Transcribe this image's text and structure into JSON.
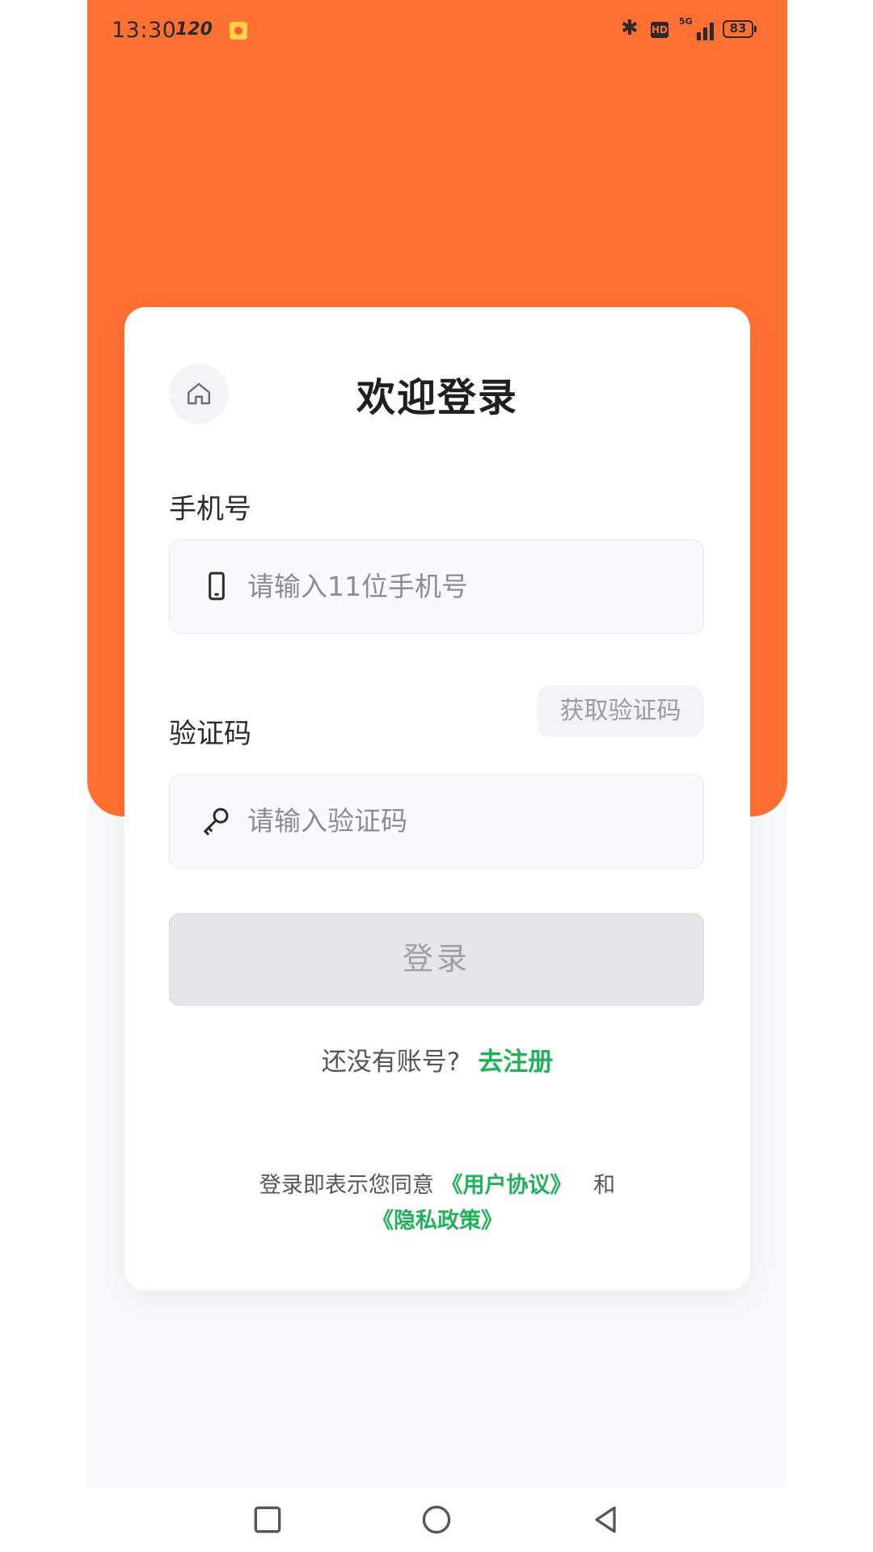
{
  "status_bar": {
    "time": "13:30",
    "refresh_rate": "120",
    "battery": "83",
    "network": "5G",
    "hd_label": "HD"
  },
  "login": {
    "title": "欢迎登录",
    "phone_label": "手机号",
    "phone_placeholder": "请输入11位手机号",
    "code_label": "验证码",
    "get_code_label": "获取验证码",
    "code_placeholder": "请输入验证码",
    "submit_label": "登录",
    "no_account_text": "还没有账号?",
    "register_link": "去注册",
    "agreement_prefix": "登录即表示您同意",
    "user_agreement": "《用户协议》",
    "and_text": "和",
    "privacy_policy": "《隐私政策》"
  },
  "colors": {
    "header": "#ff7033",
    "accent_link": "#20b15a",
    "button_disabled": "#e5e6e9"
  },
  "icons": {
    "home": "home-icon",
    "phone": "phone-icon",
    "key": "key-icon"
  },
  "nav": {
    "recent": "square-icon",
    "home": "circle-icon",
    "back": "triangle-back-icon"
  }
}
